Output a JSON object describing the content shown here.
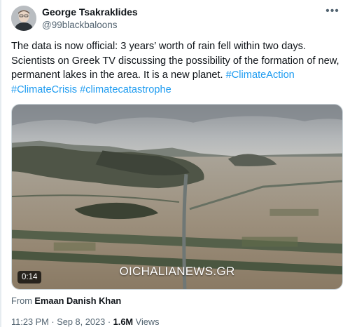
{
  "author": {
    "name": "George Tsakraklides",
    "handle": "@99blackbaloons"
  },
  "more_icon": "more-horizontal-icon",
  "tweet": {
    "text_segments": [
      {
        "type": "text",
        "value": "The data is now official: 3 years’ worth of rain fell within two days. Scientists on Greek TV discussing the possibility of the formation of new, permanent lakes in the area.  It is a new planet.  "
      },
      {
        "type": "hashtag",
        "value": "#ClimateAction"
      },
      {
        "type": "text",
        "value": " "
      },
      {
        "type": "hashtag",
        "value": "#ClimateCrisis"
      },
      {
        "type": "text",
        "value": " "
      },
      {
        "type": "hashtag",
        "value": "#climatecatastrophe"
      }
    ]
  },
  "media": {
    "watermark": "OICHALIANEWS.GR",
    "duration": "0:14"
  },
  "source": {
    "prefix": "From",
    "name": "Emaan Danish Khan"
  },
  "meta": {
    "time": "11:23 PM",
    "separator": "·",
    "date": "Sep 8, 2023",
    "views_count": "1.6M",
    "views_label": "Views"
  },
  "colors": {
    "link": "#1d9bf0",
    "secondary_text": "#536471",
    "primary_text": "#0f1419"
  }
}
